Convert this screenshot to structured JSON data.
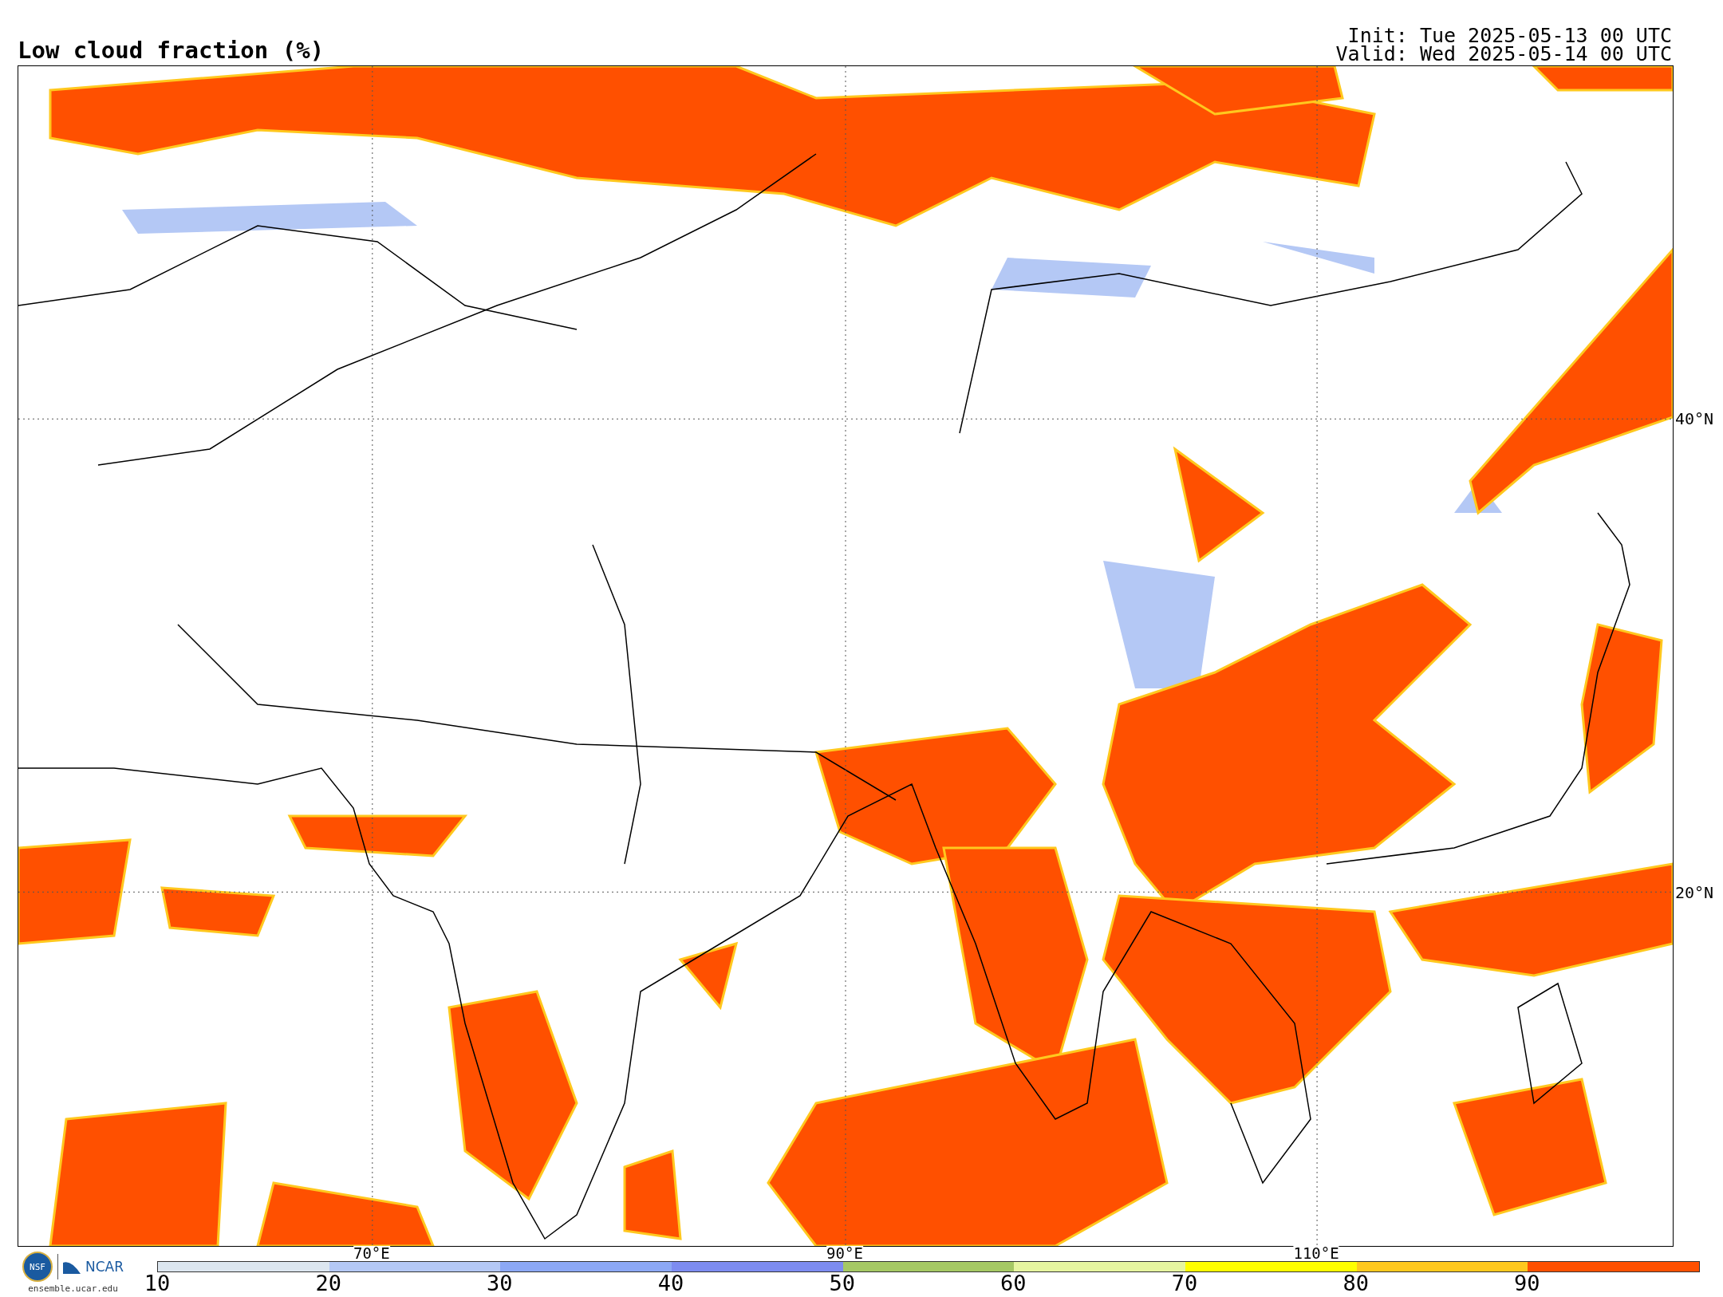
{
  "title": "Low cloud fraction (%)",
  "init": "Init: Tue 2025-05-13 00 UTC",
  "valid": "Valid: Wed 2025-05-14 00 UTC",
  "map": {
    "lat_labels": [
      "40°N",
      "20°N"
    ],
    "lon_labels": [
      "70°E",
      "90°E",
      "110°E"
    ]
  },
  "logos": {
    "agency": "NSF",
    "partner": "NCAR",
    "url": "ensemble.ucar.edu"
  },
  "colorbar": {
    "segments": [
      {
        "tick": "10",
        "color": "#dce6ef"
      },
      {
        "tick": "20",
        "color": "#b4c8f5"
      },
      {
        "tick": "30",
        "color": "#8ca8f5"
      },
      {
        "tick": "40",
        "color": "#7d8cf0"
      },
      {
        "tick": "50",
        "color": "#a5c864"
      },
      {
        "tick": "60",
        "color": "#e6f5a0"
      },
      {
        "tick": "70",
        "color": "#ffff00"
      },
      {
        "tick": "80",
        "color": "#ffc81e"
      },
      {
        "tick": "90",
        "color": "#ff5000"
      }
    ]
  }
}
